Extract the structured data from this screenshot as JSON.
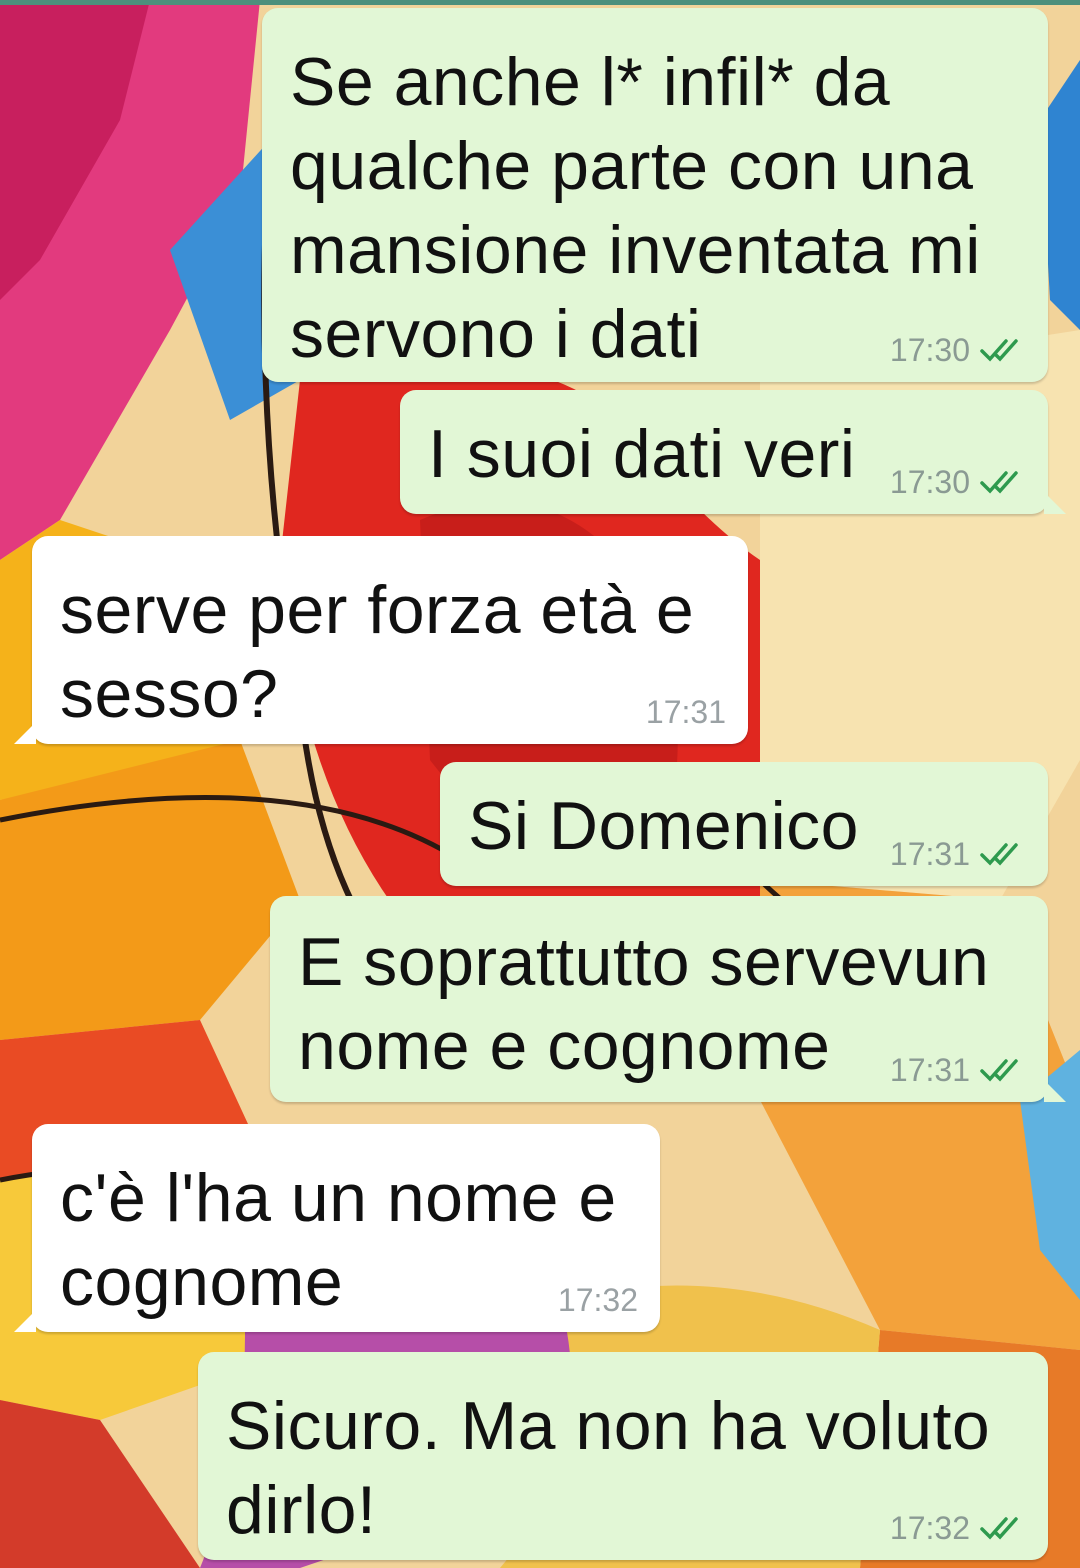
{
  "messages": [
    {
      "direction": "outgoing",
      "text": "Se anche l* infil* da qualche parte con una mansione inventata mi servono i dati",
      "time": "17:30",
      "status": "read"
    },
    {
      "direction": "outgoing",
      "text": "I suoi dati veri",
      "time": "17:30",
      "status": "read"
    },
    {
      "direction": "incoming",
      "text": "serve per forza età e sesso?",
      "time": "17:31"
    },
    {
      "direction": "outgoing",
      "text": "Si Domenico",
      "time": "17:31",
      "status": "read"
    },
    {
      "direction": "outgoing",
      "text": "E soprattutto servevun nome e cognome",
      "time": "17:31",
      "status": "read"
    },
    {
      "direction": "incoming",
      "text": "c'è l'ha un nome e cognome",
      "time": "17:32"
    },
    {
      "direction": "outgoing",
      "text": "Sicuro. Ma non ha voluto dirlo!",
      "time": "17:32",
      "status": "read"
    }
  ],
  "colors": {
    "outgoing_bubble": "#e2f7d6",
    "incoming_bubble": "#ffffff",
    "read_ticks": "#2e9a4e",
    "timestamp": "#8a9a93"
  },
  "icons": {
    "read_receipt": "double-check-icon"
  }
}
